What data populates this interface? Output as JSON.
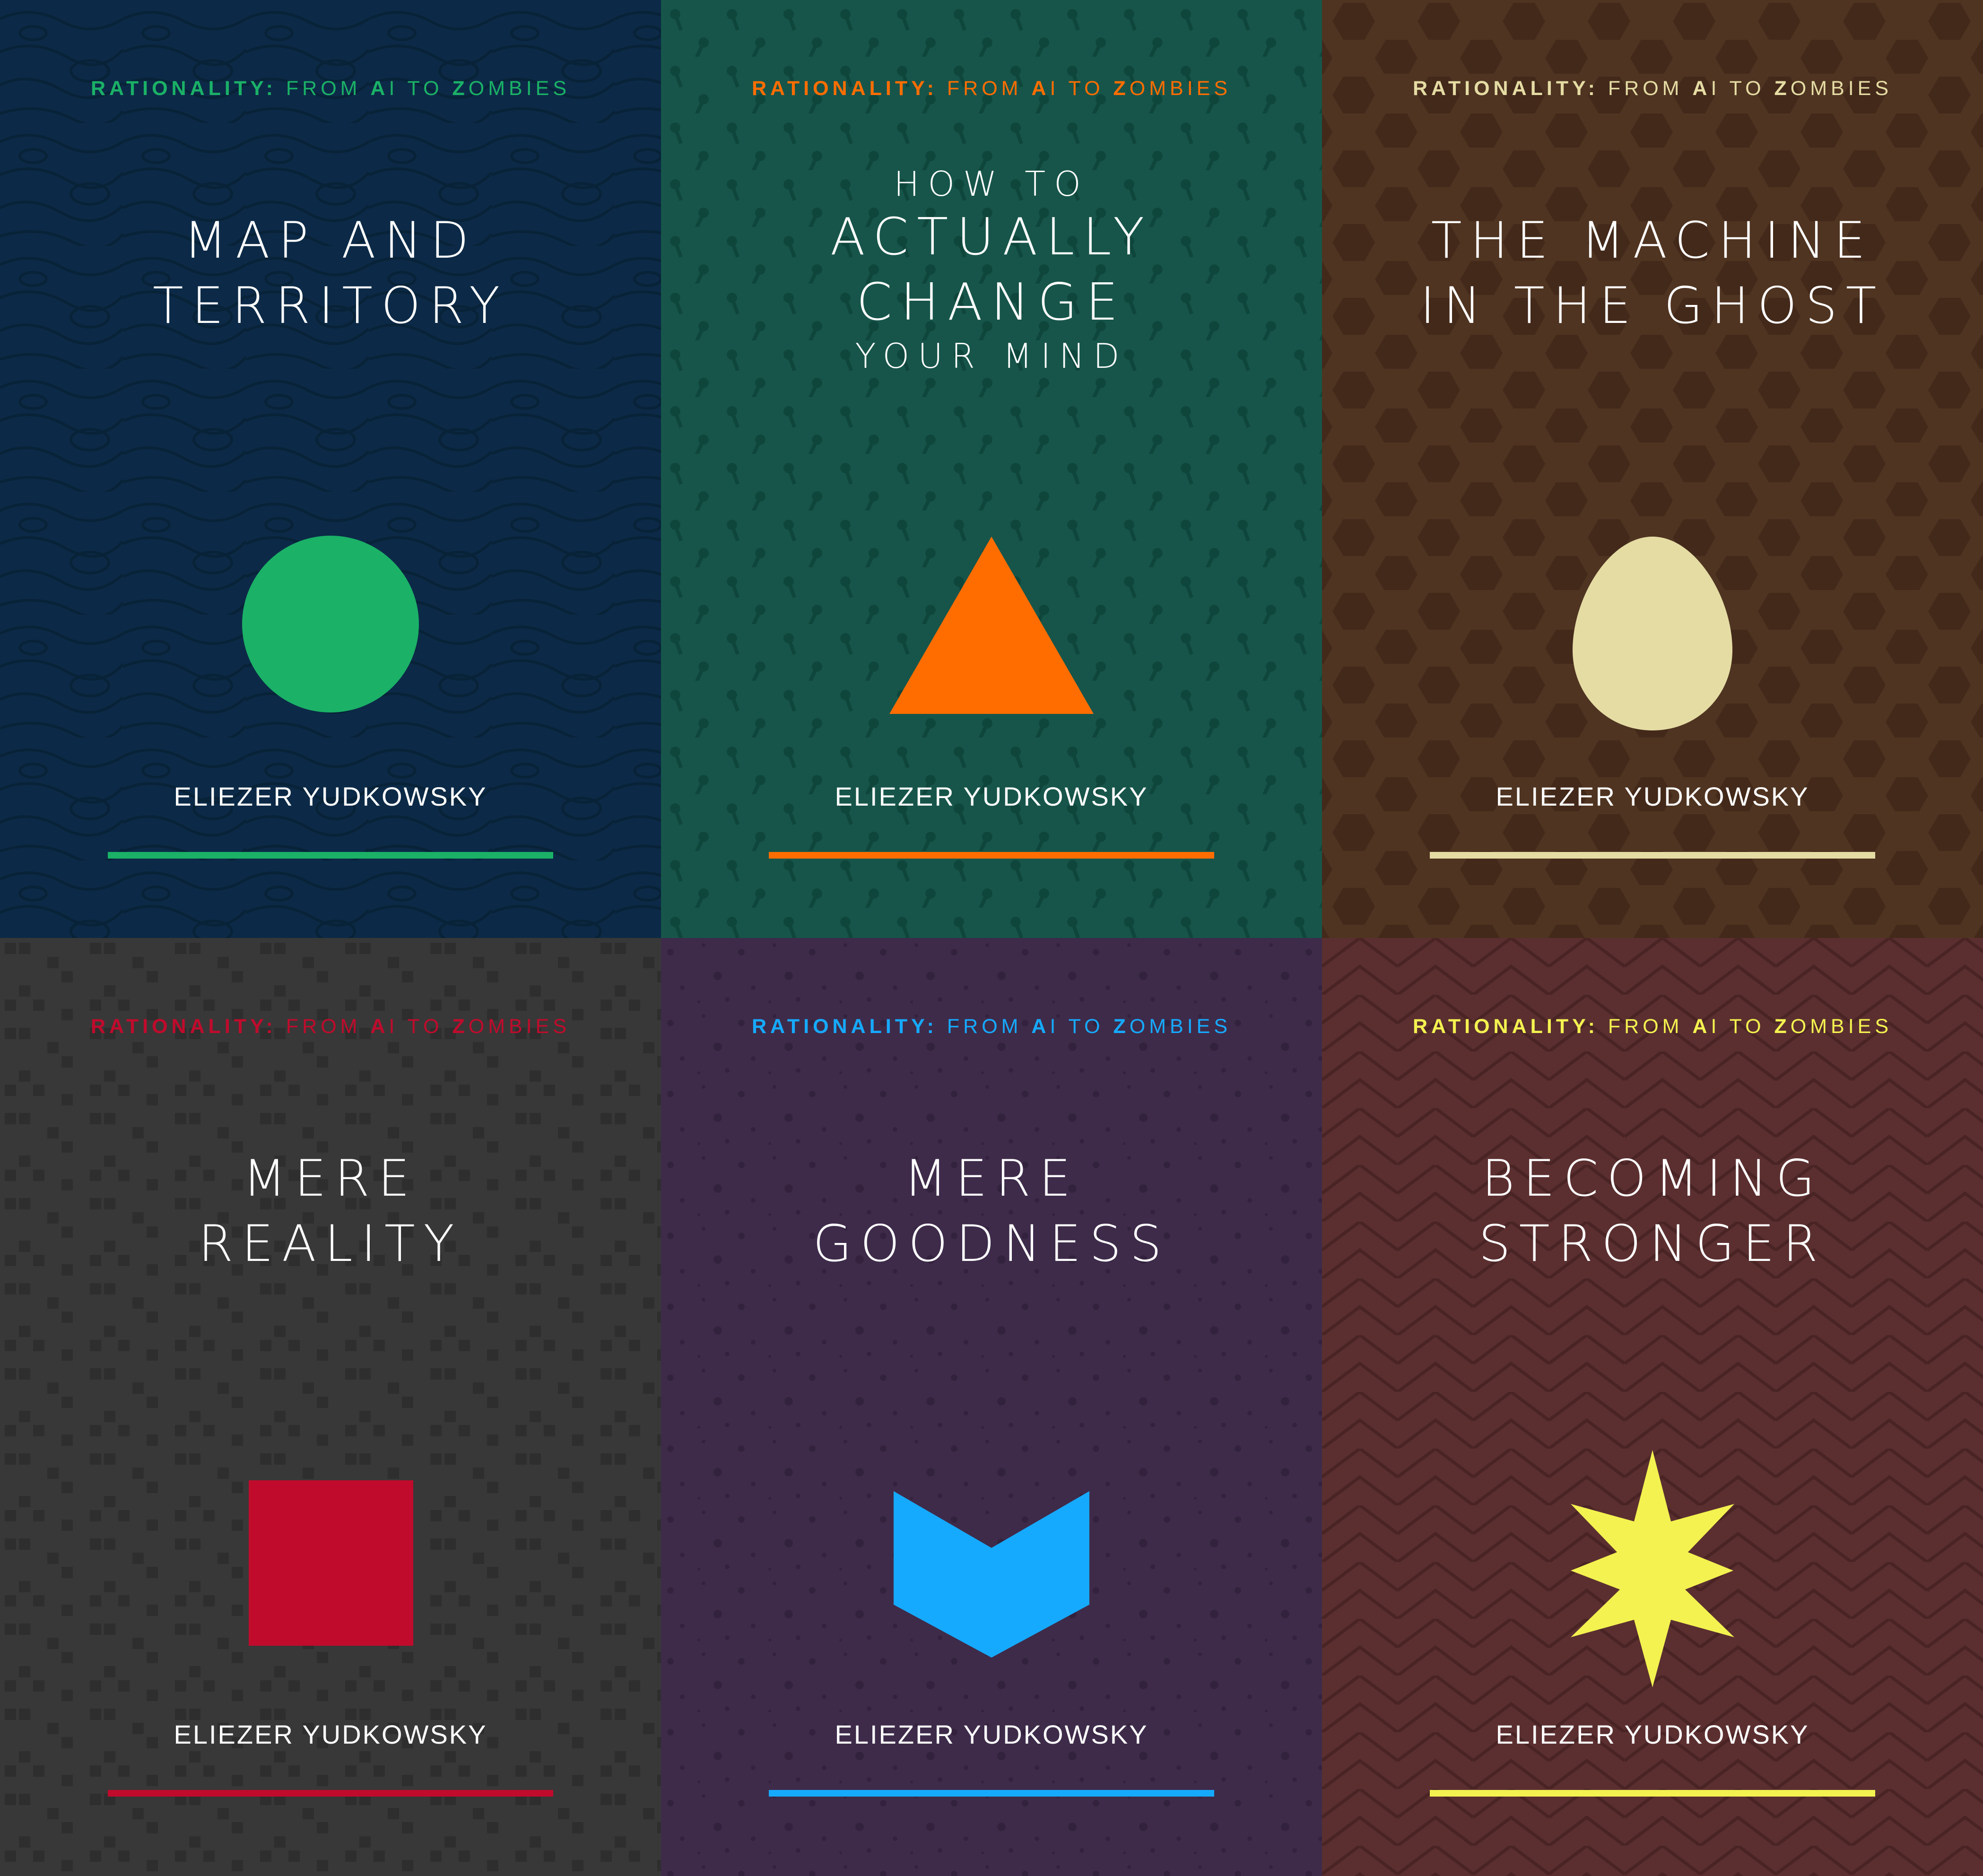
{
  "series": {
    "part1": "RATIONALITY:",
    "part2": "FROM",
    "part3": "A",
    "part4": "I TO",
    "part5": "Z",
    "part6": "OMBIES"
  },
  "covers": [
    {
      "title_lines": [
        "MAP AND",
        "TERRITORY"
      ],
      "author": "ELIEZER YUDKOWSKY",
      "shape": "circle",
      "background": "#0c2a47",
      "pattern": "#082238",
      "accent": "#1bb167"
    },
    {
      "title_lines": [
        "HOW TO",
        "ACTUALLY",
        "CHANGE",
        "YOUR MIND"
      ],
      "author": "ELIEZER YUDKOWSKY",
      "shape": "triangle",
      "background": "#17554a",
      "pattern": "#0f463c",
      "accent": "#ff6d00"
    },
    {
      "title_lines": [
        "THE MACHINE",
        "IN THE GHOST"
      ],
      "author": "ELIEZER YUDKOWSKY",
      "shape": "egg",
      "background": "#4f3421",
      "pattern": "#43291a",
      "accent": "#e5dca4"
    },
    {
      "title_lines": [
        "MERE",
        "REALITY"
      ],
      "author": "ELIEZER YUDKOWSKY",
      "shape": "square",
      "background": "#383838",
      "pattern": "#2e2e2e",
      "accent": "#c00b2c"
    },
    {
      "title_lines": [
        "MERE",
        "GOODNESS"
      ],
      "author": "ELIEZER YUDKOWSKY",
      "shape": "chevron",
      "background": "#3e2b4a",
      "pattern": "#33223e",
      "accent": "#16aaff"
    },
    {
      "title_lines": [
        "BECOMING",
        "STRONGER"
      ],
      "author": "ELIEZER YUDKOWSKY",
      "shape": "star",
      "background": "#5b2f30",
      "pattern": "#4a2425",
      "accent": "#f3f250"
    }
  ]
}
